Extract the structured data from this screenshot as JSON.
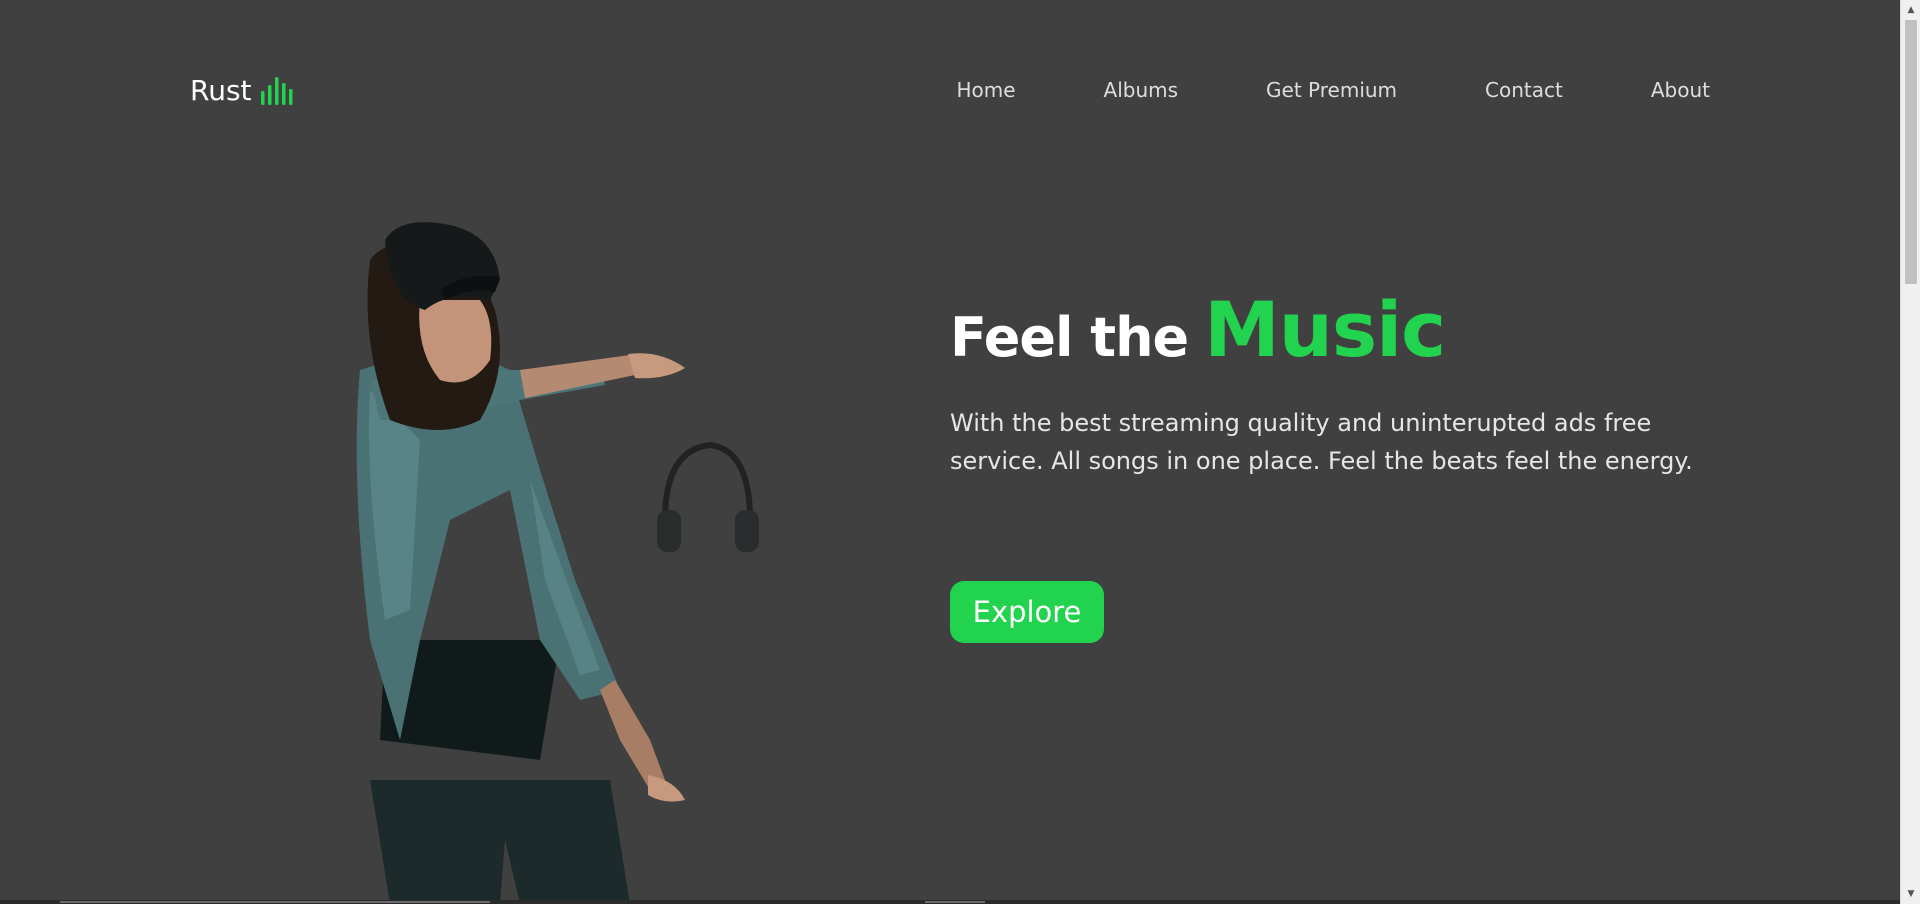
{
  "brand": {
    "name": "Rust",
    "accent_color": "#22d34f",
    "background_color": "#404040",
    "logo_icon": "equalizer-bars-icon"
  },
  "nav": {
    "items": [
      {
        "label": "Home"
      },
      {
        "label": "Albums"
      },
      {
        "label": "Get Premium"
      },
      {
        "label": "Contact"
      },
      {
        "label": "About"
      }
    ]
  },
  "hero": {
    "title_plain": "Feel the",
    "title_accent": "Music",
    "description": "With the best streaming quality and uninterupted ads free service. All songs in one place. Feel the beats feel the energy.",
    "cta_label": "Explore",
    "image": "person-dancing-with-headphones-photo"
  }
}
